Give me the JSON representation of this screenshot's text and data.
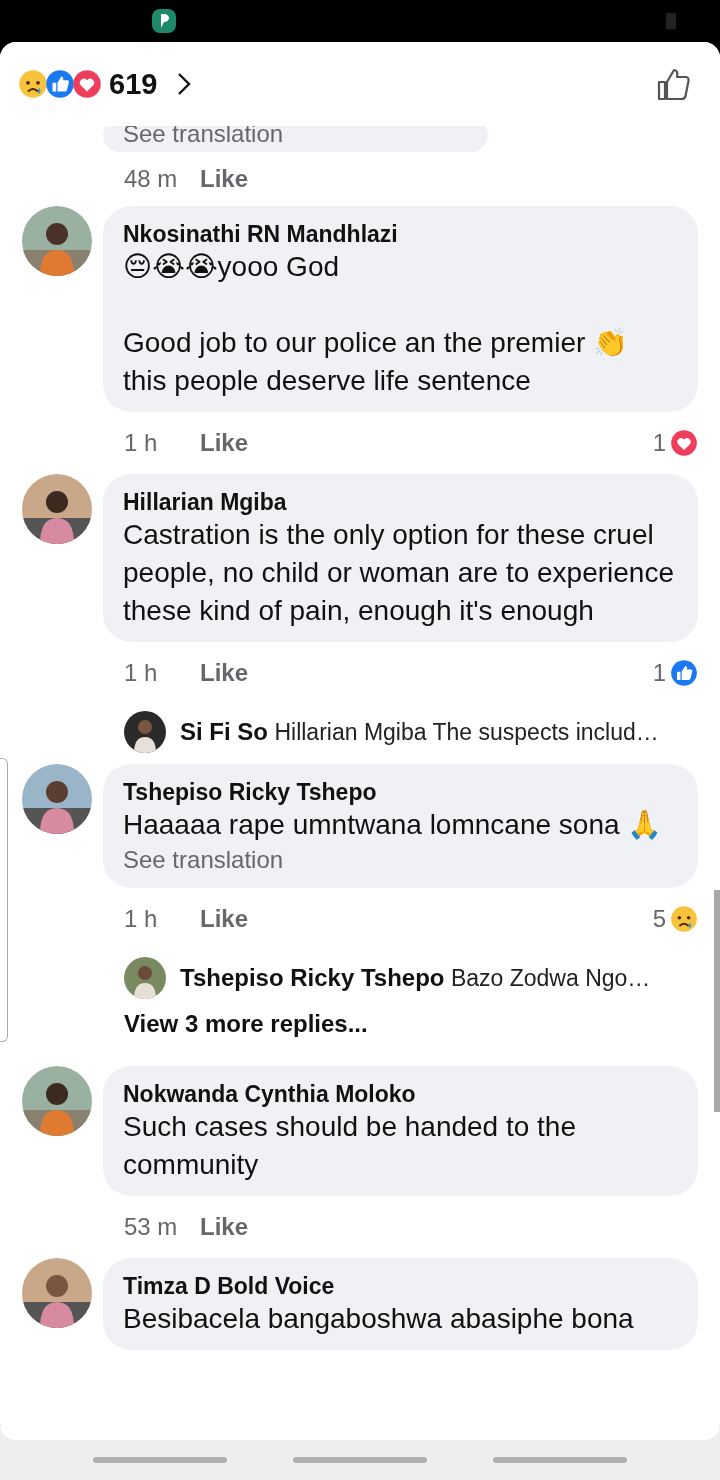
{
  "header": {
    "reactions": [
      {
        "kind": "sad"
      },
      {
        "kind": "like"
      },
      {
        "kind": "love"
      }
    ],
    "count": "619"
  },
  "items": [
    {
      "kind": "comment",
      "partial": true,
      "text": "See translation",
      "time": "48 m",
      "like": "Like"
    },
    {
      "kind": "comment",
      "name": "Nkosinathi RN Mandhlazi",
      "text": "😔😭😭yooo God\n\nGood job to our police an the premier 👏 this people deserve life sentence",
      "time": "1 h",
      "like": "Like",
      "reaction": {
        "kind": "love",
        "count": "1"
      }
    },
    {
      "kind": "comment",
      "name": "Hillarian Mgiba",
      "text": "Castration is the only option for these cruel people,  no child or woman are to experience these kind of pain, enough it's enough",
      "time": "1 h",
      "like": "Like",
      "reaction": {
        "kind": "like",
        "count": "1"
      }
    },
    {
      "kind": "reply",
      "name": "Si Fi So",
      "text": "Hillarian Mgiba The suspects includ…"
    },
    {
      "kind": "comment",
      "name": "Tshepiso Ricky Tshepo",
      "text": "Haaaaa rape umntwana lomncane sona 🙏",
      "translation": "See translation",
      "time": "1 h",
      "like": "Like",
      "reaction": {
        "kind": "sad",
        "count": "5"
      }
    },
    {
      "kind": "reply",
      "name": "Tshepiso Ricky Tshepo",
      "text": "Bazo Zodwa Ngo…"
    },
    {
      "kind": "more",
      "text": "View 3 more replies..."
    },
    {
      "kind": "comment",
      "name": "Nokwanda Cynthia Moloko",
      "text": "Such cases should be handed to the community",
      "time": "53 m",
      "like": "Like"
    },
    {
      "kind": "comment",
      "name": "Timza D Bold Voice",
      "text": "Besibacela bangaboshwa abasiphe bona"
    }
  ]
}
